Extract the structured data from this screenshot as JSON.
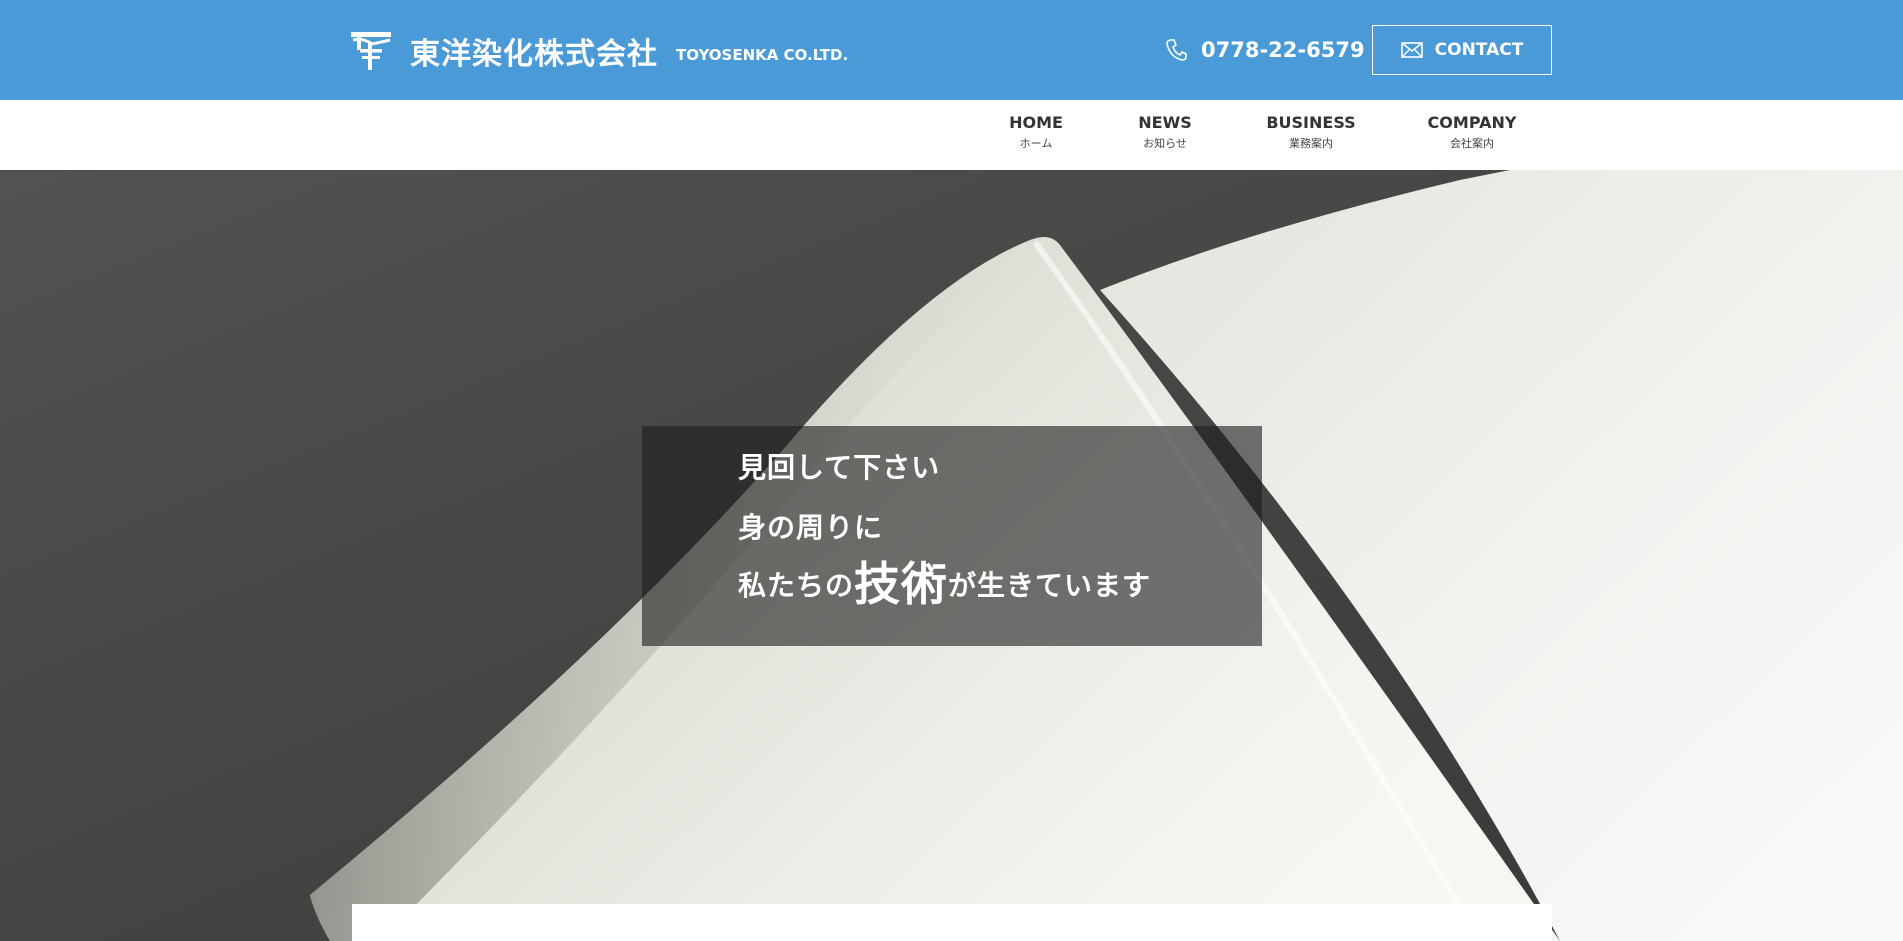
{
  "header": {
    "logo_icon": "tt-logo-icon",
    "company_name": "東洋染化株式会社",
    "company_name_en": "TOYOSENKA CO.LTD.",
    "phone_icon": "phone-icon",
    "phone": "0778-22-6579",
    "contact_icon": "mail-icon",
    "contact_label": "CONTACT",
    "background_color": "#4a9ad7"
  },
  "nav": {
    "active_index": 0,
    "items": [
      {
        "en": "HOME",
        "jp": "ホーム"
      },
      {
        "en": "NEWS",
        "jp": "お知らせ"
      },
      {
        "en": "BUSINESS",
        "jp": "業務案内"
      },
      {
        "en": "COMPANY",
        "jp": "会社案内"
      }
    ]
  },
  "hero": {
    "line1": "見回して下さい",
    "line2": "身の周りに",
    "line3_before": "私たちの",
    "line3_emphasis": "技術",
    "line3_after": "が生きています"
  }
}
